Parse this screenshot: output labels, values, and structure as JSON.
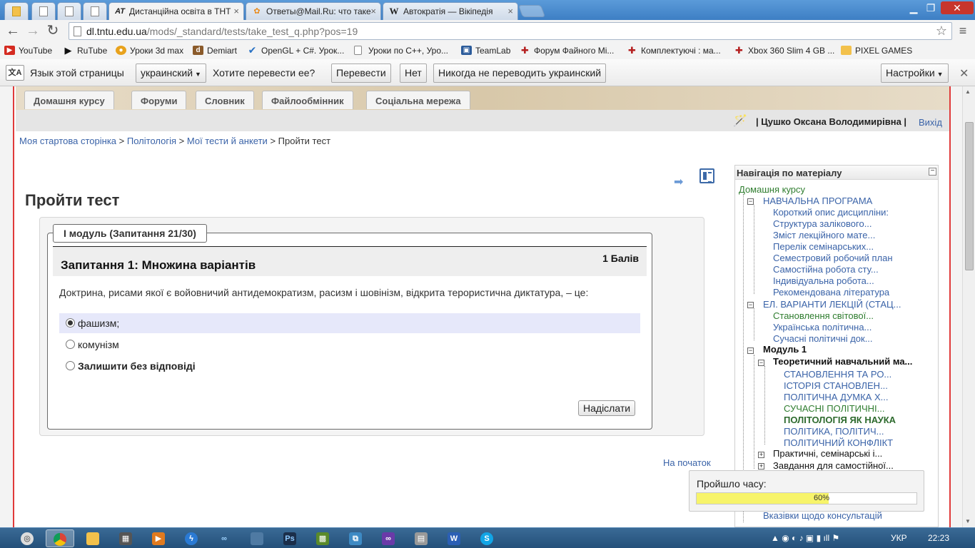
{
  "browser": {
    "tabs": [
      {
        "label": "Дистанційна освіта в ТНТ",
        "favicon": "AT",
        "active": true
      },
      {
        "label": "Ответы@Mail.Ru: что таке",
        "favicon": "mail-ru",
        "active": false
      },
      {
        "label": "Автократія — Вікіпедія",
        "favicon": "W",
        "active": false
      }
    ],
    "url_host": "dl.tntu.edu.ua",
    "url_path": "/mods/_standard/tests/take_test_q.php?pos=19",
    "bookmarks": [
      "YouTube",
      "RuTube",
      "Уроки 3d max",
      "Demiart",
      "OpenGL + C#. Урок...",
      "Уроки по C++, Уро...",
      "TeamLab",
      "Форум Файного Мі...",
      "Комплектуючі : ма...",
      "Xbox 360 Slim 4 GB ...",
      "PIXEL GAMES"
    ],
    "translate_bar": {
      "language_prompt": "Язык этой страницы",
      "language_value": "украинский",
      "question": "Хотите перевести ее?",
      "translate_btn": "Перевести",
      "no_btn": "Нет",
      "never_btn": "Никогда не переводить украинский",
      "settings_btn": "Настройки"
    }
  },
  "course_tabs": [
    "Домашня курсу",
    "Форуми",
    "Словник",
    "Файлообмінник",
    "Соціальна мережа"
  ],
  "user": {
    "name": "| Цушко Оксана Володимирівна |",
    "logout": "Вихід"
  },
  "breadcrumb": {
    "items": [
      "Моя стартова сторінка",
      "Політологія",
      "Мої тести й анкети"
    ],
    "separator": ">",
    "current": "Пройти тест"
  },
  "page_title": "Пройти тест",
  "quiz": {
    "legend": "I модуль (Запитання 21/30)",
    "question_title": "Запитання 1:   Множина варіантів",
    "grade": "1 Балів",
    "question_text": "Доктрина, рисами якої є войовничий антидемократизм, расизм і шовінізм, відкрита терористична диктатура, – це:",
    "answers": [
      {
        "label": "фашизм;",
        "checked": true
      },
      {
        "label": "комунізм",
        "checked": false
      },
      {
        "label": "Залишити без відповіді",
        "checked": false
      }
    ],
    "submit": "Надіслати",
    "to_top": "На початок"
  },
  "nav": {
    "title": "Навігація по матеріалу",
    "items": [
      "Домашня курсу",
      "НАВЧАЛЬНА ПРОГРАМА",
      "Короткий опис дисципліни:",
      "Структура залікового...",
      "Зміст лекційного мате...",
      "Перелік семінарських...",
      "Семестровий робочий план",
      "Самостійна робота сту...",
      "Індивідуальна робота...",
      "Рекомендована література",
      "ЕЛ. ВАРІАНТИ ЛЕКЦІЙ (СТАЦ...",
      "Становлення світової...",
      "Українська політична...",
      "Сучасні політичні док...",
      "Модуль 1",
      "Теоретичний навчальний ма...",
      "СТАНОВЛЕННЯ ТА РО...",
      "ІСТОРІЯ СТАНОВЛЕН...",
      "ПОЛІТИЧНА ДУМКА Х...",
      "СУЧАСНІ ПОЛІТИЧНІ...",
      "ПОЛІТОЛОГІЯ ЯК НАУКА",
      "ПОЛІТИКА, ПОЛІТИЧ...",
      "ПОЛІТИЧНИЙ КОНФЛІКТ",
      "Практичні, семінарські і...",
      "Завдання для самостійної...",
      "Вказівки щодо консультацій"
    ]
  },
  "timer": {
    "label": "Пройшло часу:",
    "percent": 60,
    "percent_text": "60%"
  },
  "taskbar": {
    "lang": "УКР",
    "time": "22:23"
  }
}
